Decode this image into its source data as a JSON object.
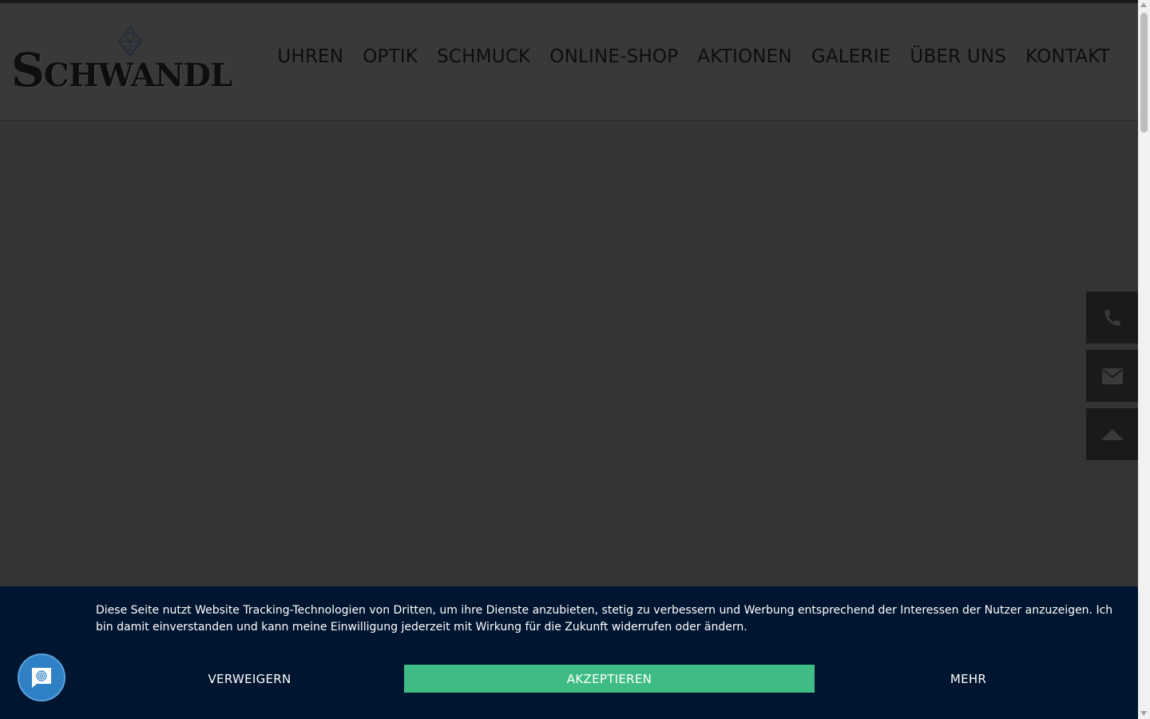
{
  "brand": {
    "logo_text_first": "S",
    "logo_text_rest": "CHWANDL"
  },
  "nav": {
    "items": [
      {
        "label": "UHREN"
      },
      {
        "label": "OPTIK"
      },
      {
        "label": "SCHMUCK"
      },
      {
        "label": "ONLINE-SHOP"
      },
      {
        "label": "AKTIONEN"
      },
      {
        "label": "GALERIE"
      },
      {
        "label": "ÜBER UNS"
      },
      {
        "label": "KONTAKT"
      }
    ]
  },
  "side_actions": {
    "icons": [
      "phone-icon",
      "mail-icon",
      "scroll-top-icon"
    ]
  },
  "cookie_banner": {
    "text": "Diese Seite nutzt Website Tracking-Technologien von Dritten, um ihre Dienste anzubieten, stetig zu verbessern und Werbung entsprechend der Interessen der Nutzer anzuzeigen. Ich bin damit einverstanden und kann meine Einwilligung jederzeit mit Wirkung für die Zukunft widerrufen oder ändern.",
    "refuse_label": "VERWEIGERN",
    "accept_label": "AKZEPTIEREN",
    "more_label": "MEHR"
  },
  "colors": {
    "overlay_background": "#343434",
    "cookie_background": "#00152f",
    "accept_button": "#3fbc84",
    "chat_bubble": "#2f80c4"
  }
}
